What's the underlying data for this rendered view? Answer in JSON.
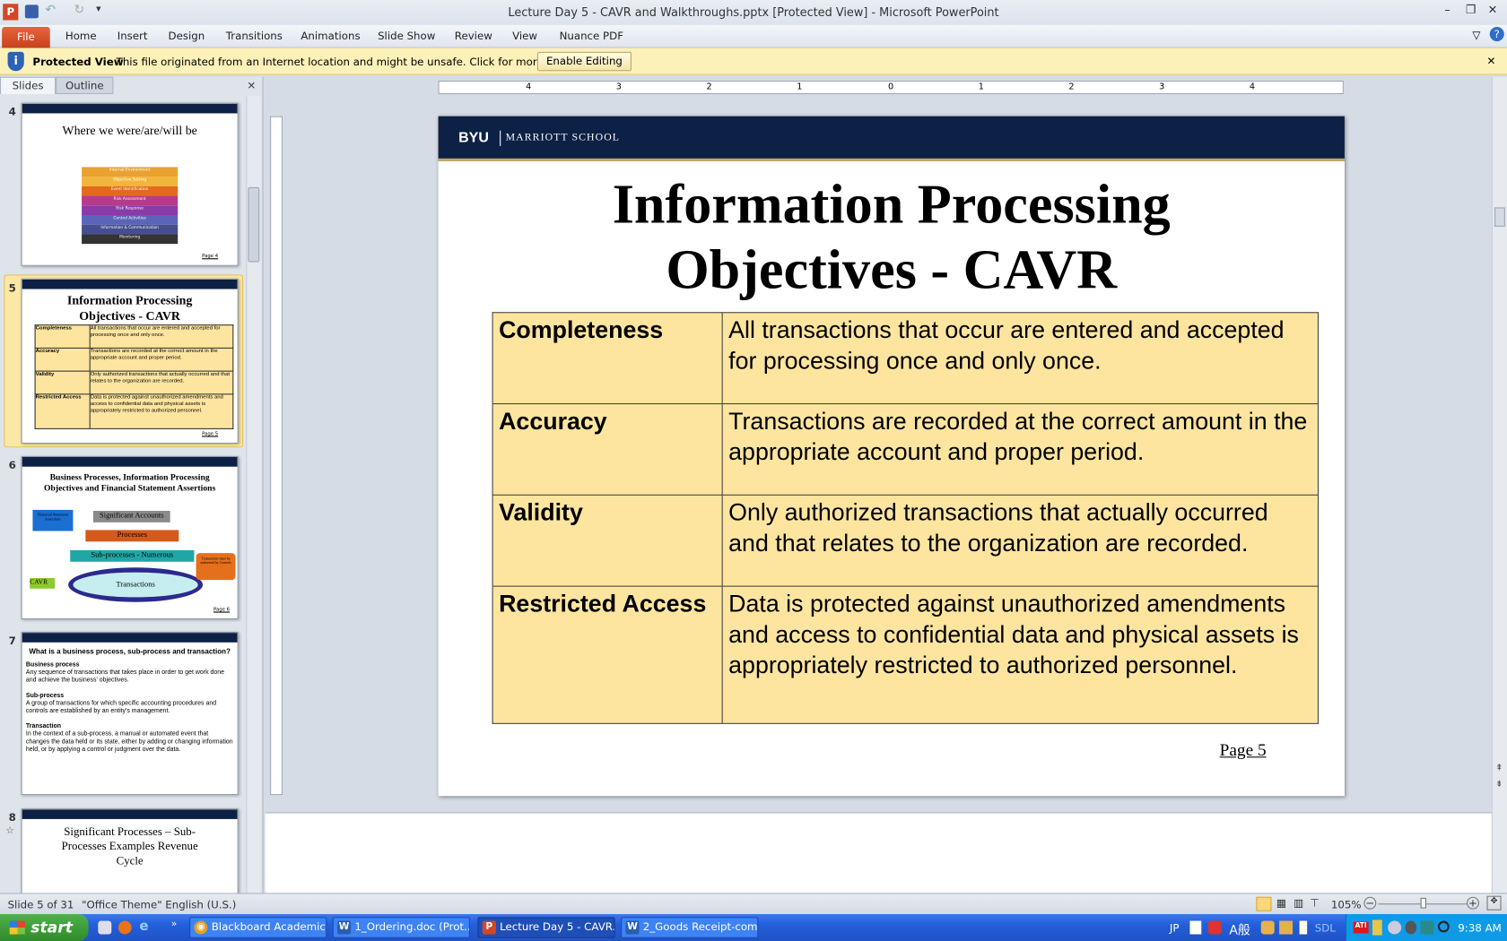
{
  "window": {
    "title": "Lecture Day 5 - CAVR and Walkthroughs.pptx [Protected View]  -  Microsoft PowerPoint"
  },
  "ribbon": {
    "file": "File",
    "tabs": [
      "Home",
      "Insert",
      "Design",
      "Transitions",
      "Animations",
      "Slide Show",
      "Review",
      "View",
      "Nuance PDF"
    ]
  },
  "protected_view": {
    "label": "Protected View",
    "message": "This file originated from an Internet location and might be unsafe. Click for more details.",
    "button": "Enable Editing"
  },
  "panel": {
    "tabs": [
      "Slides",
      "Outline"
    ],
    "close": "✕"
  },
  "thumbnails": [
    {
      "number": "4",
      "title": "Where we were/are/will be",
      "cube_layers": [
        "Internal Environment",
        "Objective Setting",
        "Event Identification",
        "Risk Assessment",
        "Risk Response",
        "Control Activities",
        "Information & Communication",
        "Monitoring"
      ],
      "page": "Page 4"
    },
    {
      "number": "5",
      "title": "Information Processing Objectives  - CAVR",
      "page": "Page 5"
    },
    {
      "number": "6",
      "title": "Business Processes, Information Processing Objectives and Financial Statement Assertions",
      "boxes": {
        "fsa": "Financial Statement Assertions",
        "accounts": "Significant Accounts",
        "processes": "Processes",
        "subprocesses": "Sub-processes - Numerous",
        "transactions": "Transactions",
        "cavr": "CAVR",
        "callout": "Transactions must be authorized by Controls"
      },
      "page": "Page 6"
    },
    {
      "number": "7",
      "title": "What is a business process, sub-process and transaction?",
      "sections": [
        {
          "h": "Business process",
          "t": "Any sequence of transactions that takes place in order to get work done and achieve the business' objectives."
        },
        {
          "h": "Sub-process",
          "t": "A group of transactions for which specific accounting procedures and controls are established by an entity's management."
        },
        {
          "h": "Transaction",
          "t": "In the context of a sub-process, a manual or automated event that changes the data held or its state, either by adding or changing information held, or by applying a control or judgment over the data."
        }
      ]
    },
    {
      "number": "8",
      "title": "Significant Processes – Sub-Processes Examples Revenue Cycle"
    }
  ],
  "slide": {
    "logo": "BYU",
    "school": "MARRIOTT SCHOOL",
    "title_line1": "Information Processing",
    "title_line2": "Objectives  - CAVR",
    "rows": [
      {
        "term": "Completeness",
        "definition": "All transactions that occur are entered and accepted for processing once and only once."
      },
      {
        "term": "Accuracy",
        "definition": "Transactions are recorded at the correct amount in the appropriate account and proper period."
      },
      {
        "term": "Validity",
        "definition": "Only authorized transactions that actually occurred and that relates to the organization are recorded."
      },
      {
        "term": "Restricted Access",
        "definition": "Data is protected against unauthorized amendments and access to confidential data and physical assets is appropriately restricted to authorized personnel."
      }
    ],
    "page": "Page 5"
  },
  "ruler": {
    "labels": [
      "4",
      "3",
      "2",
      "1",
      "0",
      "1",
      "2",
      "3",
      "4"
    ]
  },
  "status": {
    "slide": "Slide 5 of 31",
    "theme": "\"Office Theme\"",
    "language": "English (U.S.)",
    "zoom": "105%",
    "zoom_level": 105
  },
  "taskbar": {
    "start": "start",
    "tasks": [
      "Blackboard Academic ...",
      "1_Ordering.doc (Prot...",
      "Lecture Day 5 - CAVR...",
      "2_Goods Receipt-com..."
    ],
    "tray": {
      "lang": "JP",
      "ime": "A般",
      "sdl": "SDL",
      "clock": "9:38 AM"
    }
  },
  "colors": {
    "navy": "#0d2045",
    "table_fill": "#fde59f",
    "file_tab": "#d4522a",
    "protected_bar": "#fcf1b8"
  }
}
